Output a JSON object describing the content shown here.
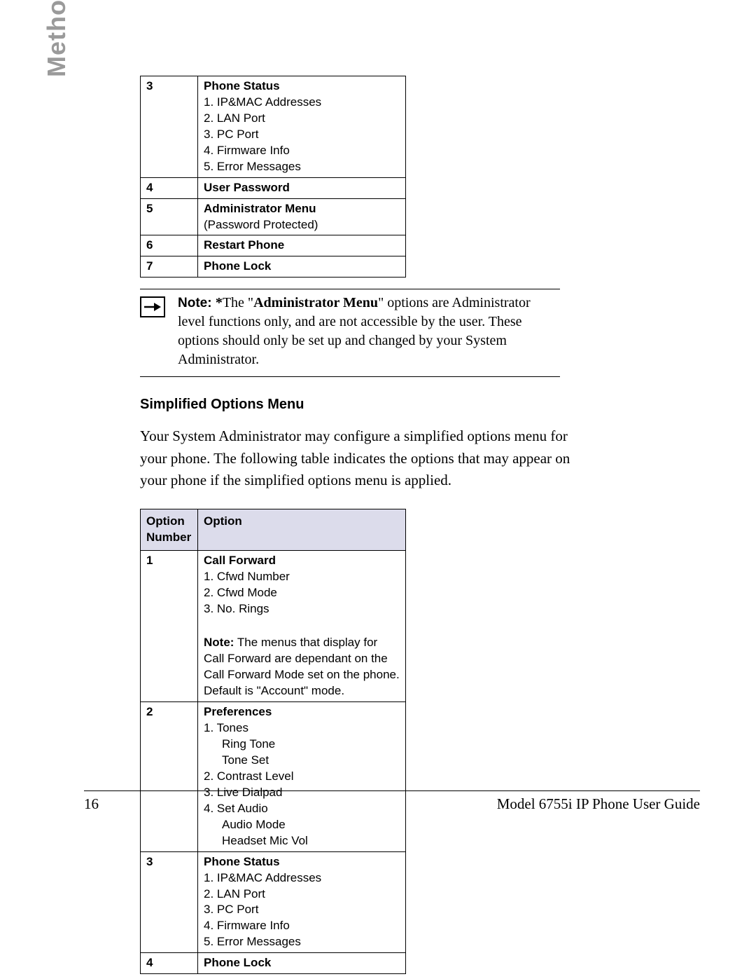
{
  "sidebar": {
    "title": "Methods for Customizing Your Phone"
  },
  "table1": {
    "rows": [
      {
        "num": "3",
        "title": "Phone Status",
        "items": [
          "1. IP&MAC Addresses",
          "2. LAN Port",
          "3. PC Port",
          "4. Firmware Info",
          "5. Error Messages"
        ]
      },
      {
        "num": "4",
        "title": "User Password",
        "items": []
      },
      {
        "num": "5",
        "title": "Administrator Menu",
        "items": [
          "(Password Protected)"
        ]
      },
      {
        "num": "6",
        "title": "Restart Phone",
        "items": []
      },
      {
        "num": "7",
        "title": "Phone Lock",
        "items": []
      }
    ]
  },
  "note": {
    "label": "Note: ",
    "asterisk": "*",
    "lead": "The \"",
    "bold": "Administrator Menu",
    "tail": "\" options are Administrator level functions only, and are not accessible by the user. These options should only be set up and changed by your System Administrator."
  },
  "section": {
    "heading": "Simplified Options Menu"
  },
  "paragraph": "Your System Administrator may configure a simplified options menu for your phone. The following table indicates the options that may appear on your phone if the simplified options menu is applied.",
  "table2": {
    "headers": {
      "col1a": "Option",
      "col1b": "Number",
      "col2": "Option"
    },
    "rows": [
      {
        "num": "1",
        "title": "Call Forward",
        "items": [
          "1. Cfwd Number",
          "2. Cfwd Mode",
          "3. No. Rings"
        ],
        "note_label": "Note:",
        "note": " The menus that display for Call Forward are dependant on the Call Forward Mode set on the phone. Default is \"Account\" mode."
      },
      {
        "num": "2",
        "title": "Preferences",
        "lines": [
          {
            "text": "1. Tones",
            "indent": 0
          },
          {
            "text": "Ring Tone",
            "indent": 1
          },
          {
            "text": "Tone Set",
            "indent": 1
          },
          {
            "text": "2. Contrast Level",
            "indent": 0
          },
          {
            "text": "3. Live Dialpad",
            "indent": 0
          },
          {
            "text": "4. Set Audio",
            "indent": 0
          },
          {
            "text": "Audio Mode",
            "indent": 1
          },
          {
            "text": "Headset Mic Vol",
            "indent": 1
          }
        ]
      },
      {
        "num": "3",
        "title": "Phone Status",
        "items": [
          "1. IP&MAC Addresses",
          "2. LAN Port",
          "3. PC Port",
          "4. Firmware Info",
          "5. Error Messages"
        ]
      },
      {
        "num": "4",
        "title": "Phone Lock",
        "items": []
      }
    ]
  },
  "footer": {
    "page": "16",
    "guide": "Model 6755i IP Phone User Guide"
  }
}
